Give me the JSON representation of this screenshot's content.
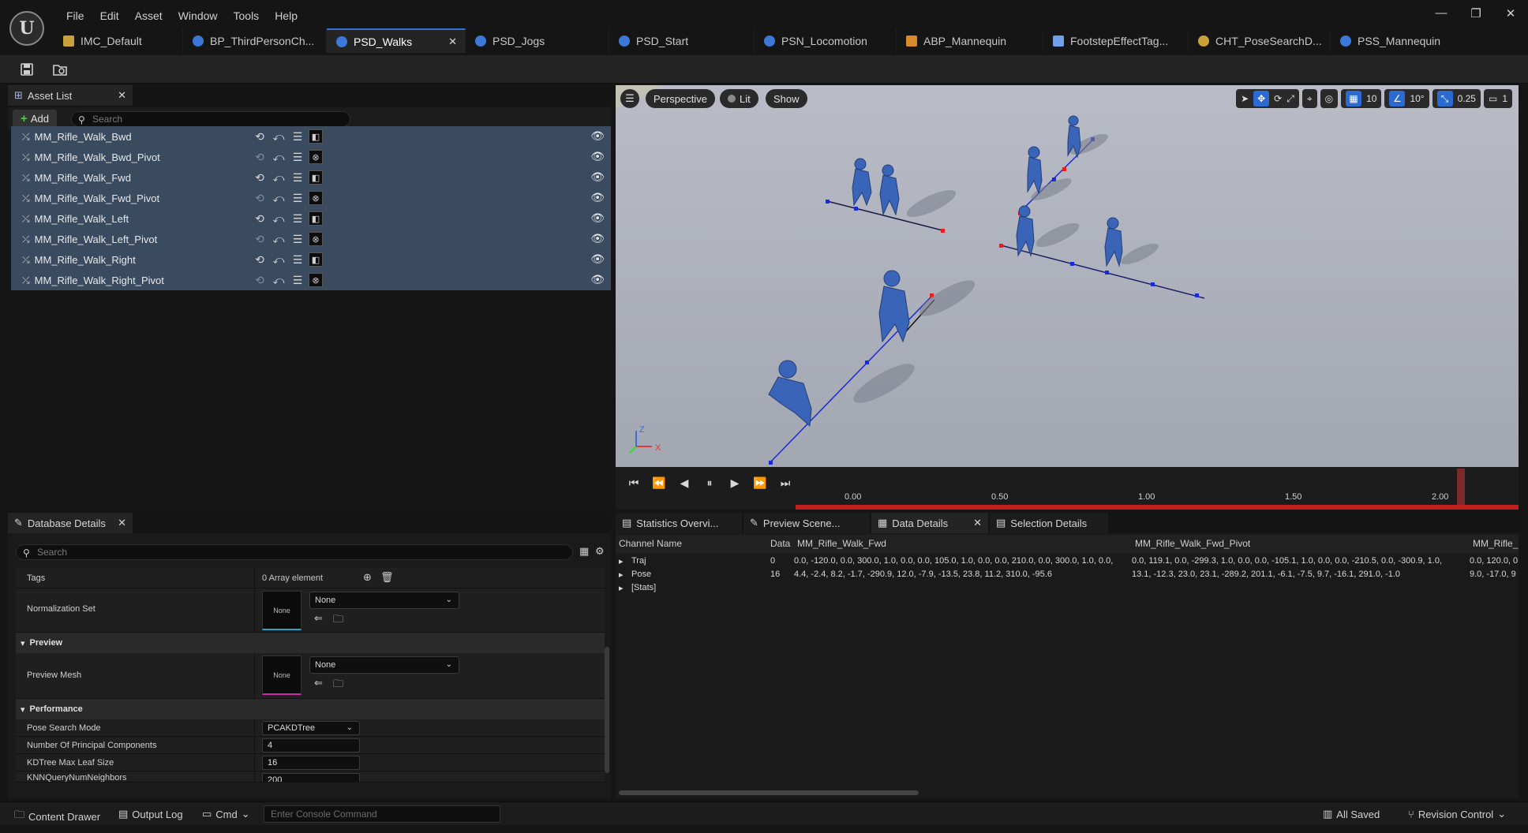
{
  "menu": [
    "File",
    "Edit",
    "Asset",
    "Window",
    "Tools",
    "Help"
  ],
  "window_controls": {
    "minimize": "—",
    "restore": "❐",
    "close": "✕"
  },
  "tabs": [
    {
      "label": "IMC_Default",
      "color": "#c9a33a"
    },
    {
      "label": "BP_ThirdPersonCh...",
      "color": "#3c78d8"
    },
    {
      "label": "PSD_Walks",
      "color": "#3c78d8",
      "active": true
    },
    {
      "label": "PSD_Jogs",
      "color": "#3c78d8"
    },
    {
      "label": "PSD_Start",
      "color": "#3c78d8"
    },
    {
      "label": "PSN_Locomotion",
      "color": "#3c78d8"
    },
    {
      "label": "ABP_Mannequin",
      "color": "#d88a2a"
    },
    {
      "label": "FootstepEffectTag...",
      "color": "#6fa0e8"
    },
    {
      "label": "CHT_PoseSearchD...",
      "color": "#c9a33a"
    },
    {
      "label": "PSS_Mannequin",
      "color": "#3c78d8"
    }
  ],
  "asset_list": {
    "title": "Asset List",
    "add_label": "Add",
    "search_placeholder": "Search",
    "items": [
      {
        "name": "MM_Rifle_Walk_Bwd",
        "loop": true
      },
      {
        "name": "MM_Rifle_Walk_Bwd_Pivot",
        "loop": false
      },
      {
        "name": "MM_Rifle_Walk_Fwd",
        "loop": true
      },
      {
        "name": "MM_Rifle_Walk_Fwd_Pivot",
        "loop": false
      },
      {
        "name": "MM_Rifle_Walk_Left",
        "loop": true
      },
      {
        "name": "MM_Rifle_Walk_Left_Pivot",
        "loop": false
      },
      {
        "name": "MM_Rifle_Walk_Right",
        "loop": true
      },
      {
        "name": "MM_Rifle_Walk_Right_Pivot",
        "loop": false
      }
    ]
  },
  "viewport": {
    "perspective": "Perspective",
    "lit": "Lit",
    "show": "Show",
    "grid_snap": "10",
    "rot_snap": "10°",
    "scale_snap": "0.25",
    "camera_speed": "1",
    "axis_z": "Z",
    "axis_x": "X"
  },
  "timeline": {
    "ticks": [
      "0.00",
      "0.50",
      "1.00",
      "1.50",
      "2.00"
    ]
  },
  "database_details": {
    "title": "Database Details",
    "search_placeholder": "Search",
    "tags_label": "Tags",
    "tags_value": "0 Array element",
    "normalization_label": "Normalization Set",
    "normalization_value": "None",
    "normalization_thumb": "None",
    "preview_section": "Preview",
    "preview_mesh_label": "Preview Mesh",
    "preview_mesh_value": "None",
    "preview_mesh_thumb": "None",
    "performance_section": "Performance",
    "pose_search_mode_label": "Pose Search Mode",
    "pose_search_mode_value": "PCAKDTree",
    "num_pc_label": "Number Of Principal Components",
    "num_pc_value": "4",
    "kdtree_leaf_label": "KDTree Max Leaf Size",
    "kdtree_leaf_value": "16",
    "knn_label": "KNNQueryNumNeighbors",
    "knn_value": "200"
  },
  "bottom_tabs": [
    "Statistics Overvi...",
    "Preview Scene...",
    "Data Details",
    "Selection Details"
  ],
  "data_grid": {
    "headers": [
      "Channel Name",
      "Data",
      "MM_Rifle_Walk_Fwd",
      "MM_Rifle_Walk_Fwd_Pivot",
      "MM_Rifle_"
    ],
    "rows": [
      {
        "name": "Traj",
        "data": "0",
        "col1": "0.0, -120.0, 0.0, 300.0, 1.0, 0.0, 0.0, 105.0, 1.0, 0.0, 0.0, 210.0, 0.0, 300.0, 1.0, 0.0,",
        "col2": "0.0, 119.1, 0.0, -299.3, 1.0, 0.0, 0.0, -105.1, 1.0, 0.0, 0.0, -210.5, 0.0, -300.9, 1.0,",
        "col3": "0.0, 120.0, 0"
      },
      {
        "name": "Pose",
        "data": "16",
        "col1": "4.4, -2.4, 8.2, -1.7, -290.9, 12.0, -7.9, -13.5, 23.8, 11.2, 310.0, -95.6",
        "col2": "13.1, -12.3, 23.0, 23.1, -289.2, 201.1, -6.1, -7.5, 9.7, -16.1, 291.0, -1.0",
        "col3": "9.0, -17.0, 9"
      },
      {
        "name": "[Stats]",
        "data": "",
        "col1": "",
        "col2": "",
        "col3": ""
      }
    ]
  },
  "statusbar": {
    "content_drawer": "Content Drawer",
    "output_log": "Output Log",
    "cmd": "Cmd",
    "console_placeholder": "Enter Console Command",
    "all_saved": "All Saved",
    "revision_control": "Revision Control"
  },
  "icons": [
    "unreal-logo-icon",
    "save-icon",
    "browse-icon",
    "eye-icon",
    "loop-icon",
    "mirror-icon",
    "search-icon",
    "play-icon",
    "pause-icon"
  ]
}
